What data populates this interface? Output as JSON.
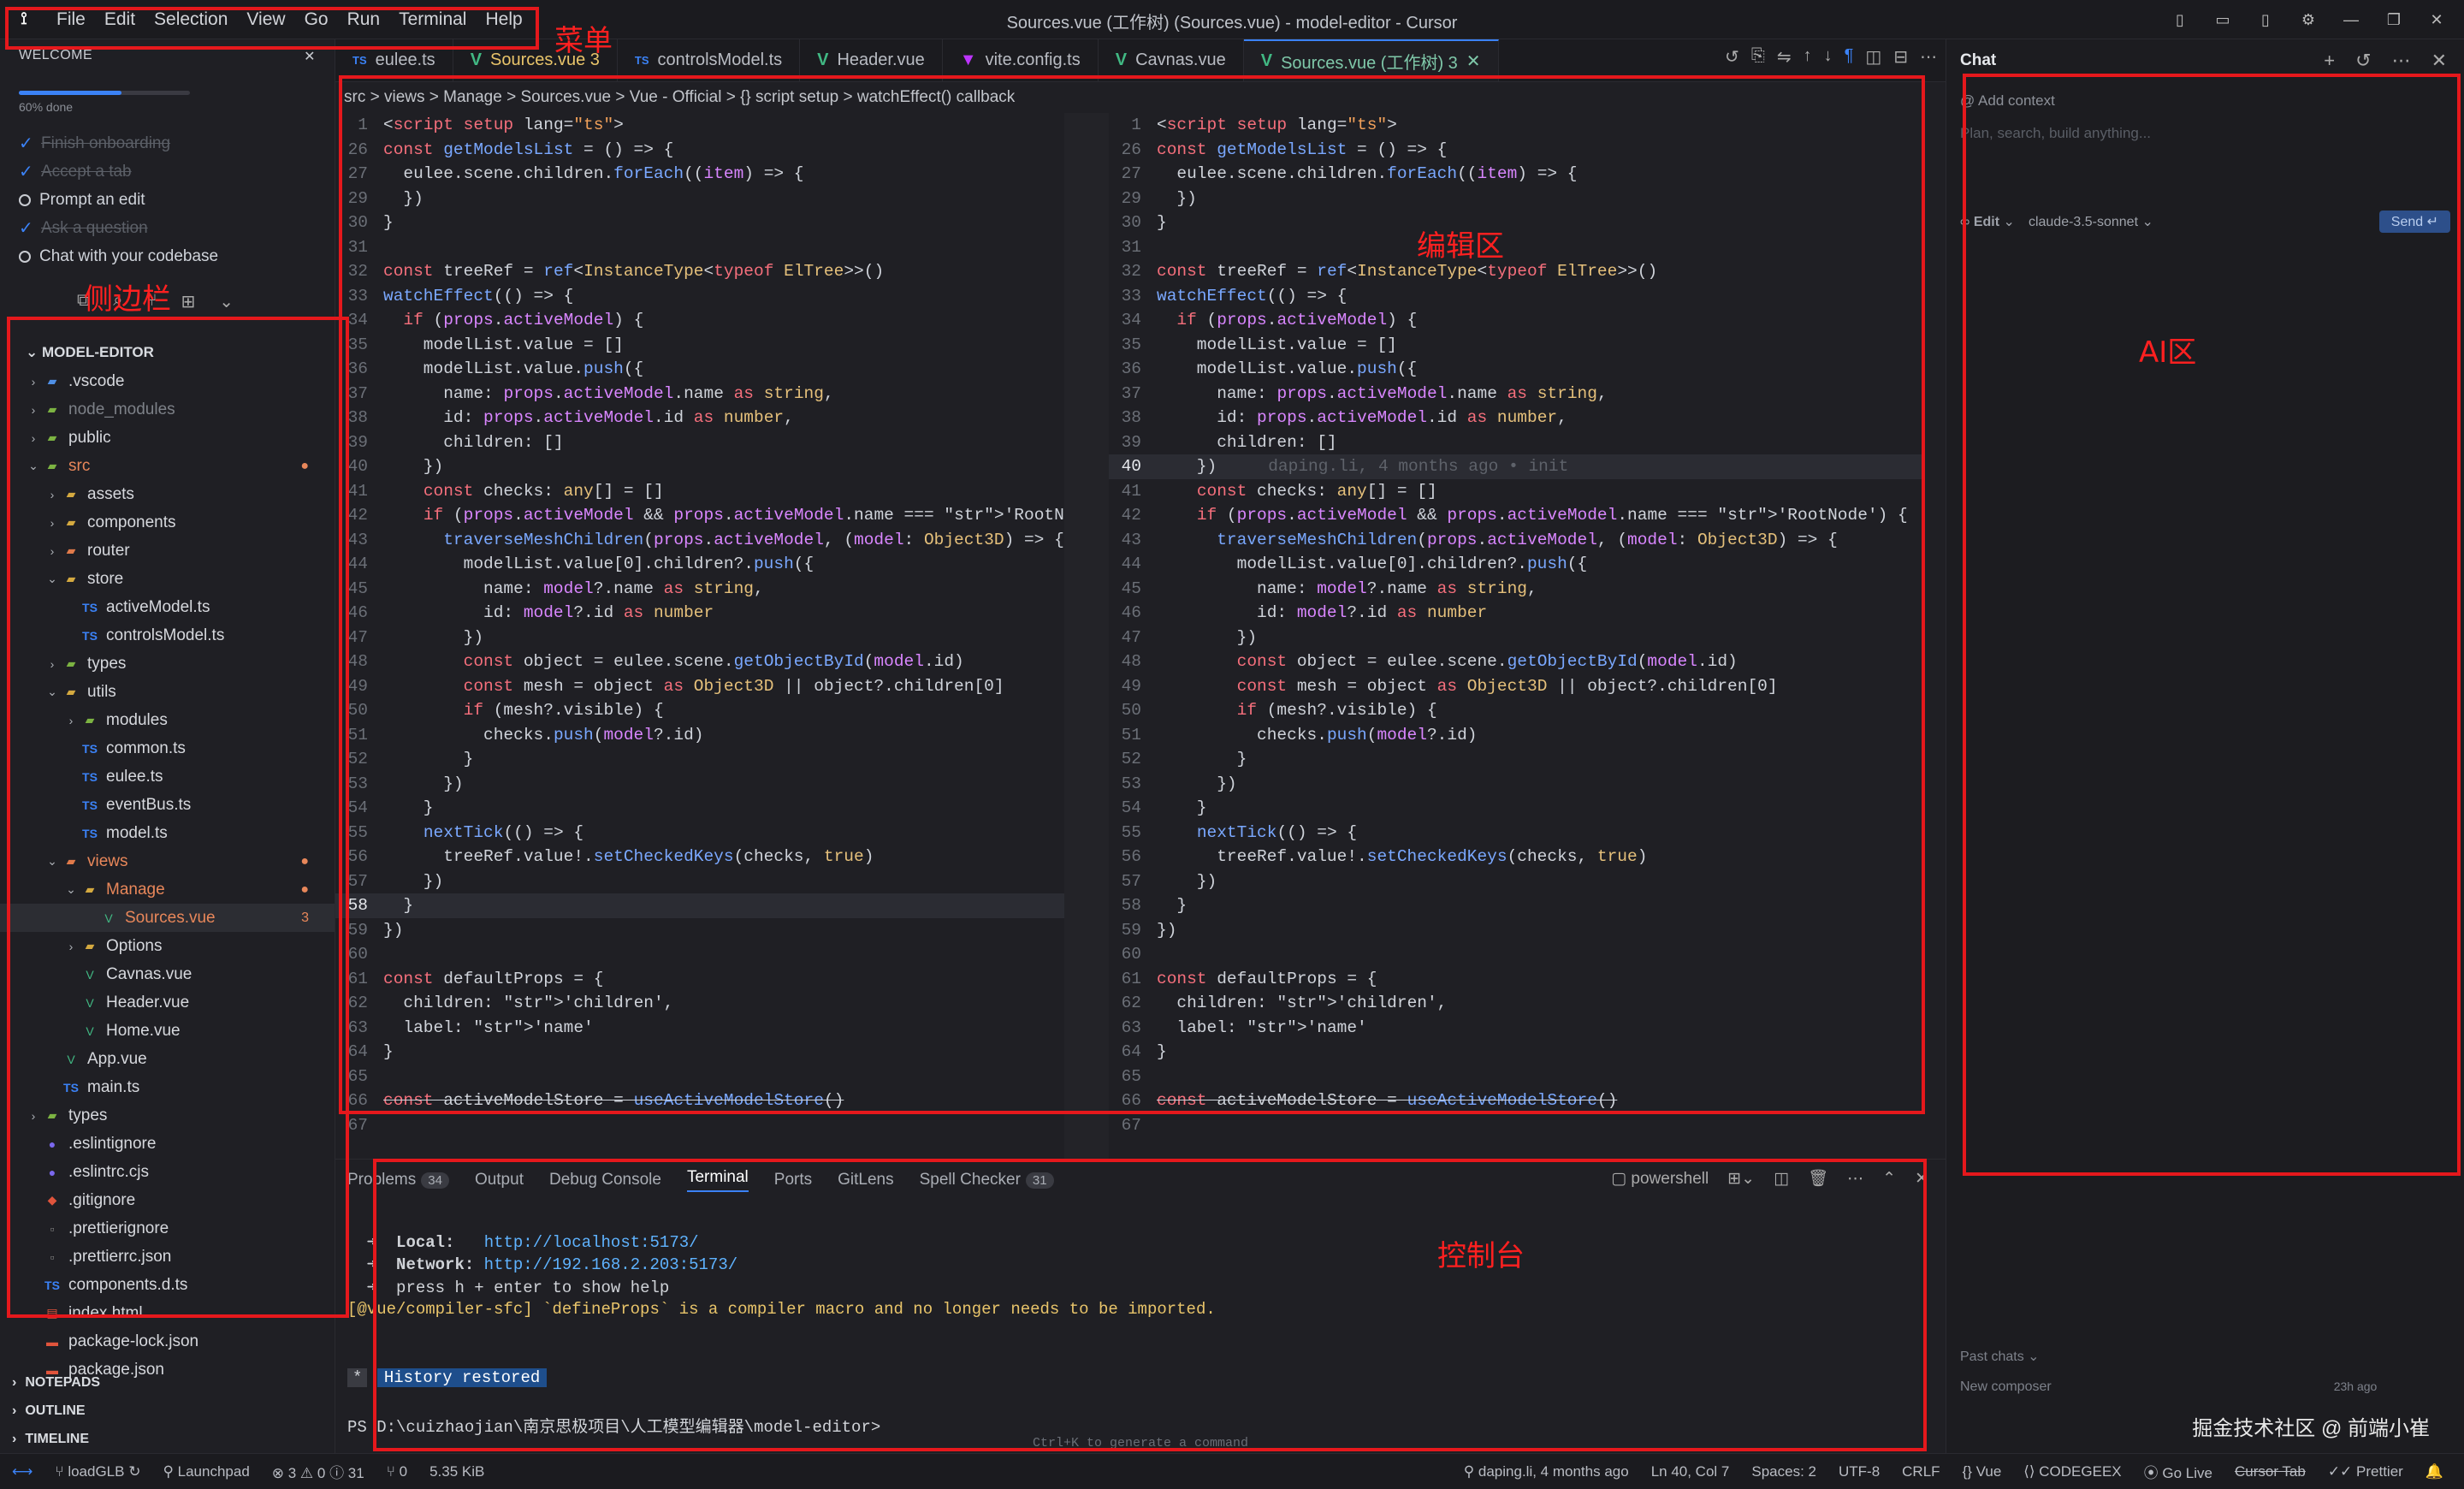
{
  "window": {
    "title": "Sources.vue (工作树) (Sources.vue) - model-editor - Cursor"
  },
  "menu": [
    "File",
    "Edit",
    "Selection",
    "View",
    "Go",
    "Run",
    "Terminal",
    "Help"
  ],
  "annotations": {
    "menu": "菜单",
    "sidebar": "侧边栏",
    "editor": "编辑区",
    "ai": "AI区",
    "console": "控制台"
  },
  "welcome": {
    "title": "WELCOME",
    "progress_text": "60% done",
    "progress": 0.6,
    "items": [
      {
        "label": "Finish onboarding",
        "done": true
      },
      {
        "label": "Accept a tab",
        "done": true
      },
      {
        "label": "Prompt an edit",
        "done": false
      },
      {
        "label": "Ask a question",
        "done": true
      },
      {
        "label": "Chat with your codebase",
        "done": false
      }
    ]
  },
  "explorer": {
    "title": "MODEL-EDITOR",
    "items": [
      {
        "label": ".vscode",
        "depth": 0,
        "kind": "folder",
        "open": false,
        "color": "#4f8fe6"
      },
      {
        "label": "node_modules",
        "depth": 0,
        "kind": "folder",
        "open": false,
        "color": "#7cb342",
        "dim": true
      },
      {
        "label": "public",
        "depth": 0,
        "kind": "folder",
        "open": false,
        "color": "#7cb342"
      },
      {
        "label": "src",
        "depth": 0,
        "kind": "folder",
        "open": true,
        "color": "#7cb342",
        "accent": true,
        "badge": "●"
      },
      {
        "label": "assets",
        "depth": 1,
        "kind": "folder",
        "open": false,
        "color": "#d4a940"
      },
      {
        "label": "components",
        "depth": 1,
        "kind": "folder",
        "open": false,
        "color": "#d4a940"
      },
      {
        "label": "router",
        "depth": 1,
        "kind": "folder",
        "open": false,
        "color": "#e07a4a"
      },
      {
        "label": "store",
        "depth": 1,
        "kind": "folder",
        "open": true,
        "color": "#d4a940"
      },
      {
        "label": "activeModel.ts",
        "depth": 2,
        "kind": "ts"
      },
      {
        "label": "controlsModel.ts",
        "depth": 2,
        "kind": "ts"
      },
      {
        "label": "types",
        "depth": 1,
        "kind": "folder",
        "open": false,
        "color": "#7cb342"
      },
      {
        "label": "utils",
        "depth": 1,
        "kind": "folder",
        "open": true,
        "color": "#d4a940"
      },
      {
        "label": "modules",
        "depth": 2,
        "kind": "folder",
        "open": false,
        "color": "#7cb342"
      },
      {
        "label": "common.ts",
        "depth": 2,
        "kind": "ts"
      },
      {
        "label": "eulee.ts",
        "depth": 2,
        "kind": "ts"
      },
      {
        "label": "eventBus.ts",
        "depth": 2,
        "kind": "ts"
      },
      {
        "label": "model.ts",
        "depth": 2,
        "kind": "ts"
      },
      {
        "label": "views",
        "depth": 1,
        "kind": "folder",
        "open": true,
        "color": "#e07a4a",
        "accent": true,
        "badge": "●"
      },
      {
        "label": "Manage",
        "depth": 2,
        "kind": "folder",
        "open": true,
        "color": "#d4a940",
        "accent": true,
        "badge": "●"
      },
      {
        "label": "Sources.vue",
        "depth": 3,
        "kind": "vue",
        "accent": true,
        "selected": true,
        "badge": "3"
      },
      {
        "label": "Options",
        "depth": 2,
        "kind": "folder",
        "open": false,
        "color": "#d4a940"
      },
      {
        "label": "Cavnas.vue",
        "depth": 2,
        "kind": "vue"
      },
      {
        "label": "Header.vue",
        "depth": 2,
        "kind": "vue"
      },
      {
        "label": "Home.vue",
        "depth": 2,
        "kind": "vue"
      },
      {
        "label": "App.vue",
        "depth": 1,
        "kind": "vue"
      },
      {
        "label": "main.ts",
        "depth": 1,
        "kind": "ts"
      },
      {
        "label": "types",
        "depth": 0,
        "kind": "folder",
        "open": false,
        "color": "#7cb342"
      },
      {
        "label": ".eslintignore",
        "depth": 0,
        "kind": "dot",
        "color": "#7b68ee"
      },
      {
        "label": ".eslintrc.cjs",
        "depth": 0,
        "kind": "dot",
        "color": "#7b68ee"
      },
      {
        "label": ".gitignore",
        "depth": 0,
        "kind": "git"
      },
      {
        "label": ".prettierignore",
        "depth": 0,
        "kind": "plain"
      },
      {
        "label": ".prettierrc.json",
        "depth": 0,
        "kind": "plain"
      },
      {
        "label": "components.d.ts",
        "depth": 0,
        "kind": "ts"
      },
      {
        "label": "index.html",
        "depth": 0,
        "kind": "html"
      },
      {
        "label": "package-lock.json",
        "depth": 0,
        "kind": "json"
      },
      {
        "label": "package.json",
        "depth": 0,
        "kind": "json"
      }
    ],
    "footer": [
      "NOTEPADS",
      "OUTLINE",
      "TIMELINE"
    ]
  },
  "tabs": [
    {
      "label": "eulee.ts",
      "kind": "ts"
    },
    {
      "label": "Sources.vue 3",
      "kind": "vue",
      "warn": true
    },
    {
      "label": "controlsModel.ts",
      "kind": "ts"
    },
    {
      "label": "Header.vue",
      "kind": "vue"
    },
    {
      "label": "vite.config.ts",
      "kind": "vite"
    },
    {
      "label": "Cavnas.vue",
      "kind": "vue"
    },
    {
      "label": "Sources.vue (工作树) 3",
      "kind": "vue",
      "active": true
    }
  ],
  "breadcrumb": "src > views > Manage > Sources.vue > Vue - Official > {} script setup > watchEffect() callback",
  "code": [
    {
      "n": "1",
      "t": "<script setup lang=\"ts\">"
    },
    {
      "n": "26",
      "t": "const getModelsList = () => {"
    },
    {
      "n": "27",
      "t": "  eulee.scene.children.forEach((item) => {"
    },
    {
      "n": "29",
      "t": "  })"
    },
    {
      "n": "30",
      "t": "}"
    },
    {
      "n": "31",
      "t": ""
    },
    {
      "n": "32",
      "t": "const treeRef = ref<InstanceType<typeof ElTree>>()"
    },
    {
      "n": "33",
      "t": "watchEffect(() => {"
    },
    {
      "n": "34",
      "t": "  if (props.activeModel) {"
    },
    {
      "n": "35",
      "t": "    modelList.value = []"
    },
    {
      "n": "36",
      "t": "    modelList.value.push({"
    },
    {
      "n": "37",
      "t": "      name: props.activeModel.name as string,"
    },
    {
      "n": "38",
      "t": "      id: props.activeModel.id as number,"
    },
    {
      "n": "39",
      "t": "      children: []"
    },
    {
      "n": "40",
      "t": "    })"
    },
    {
      "n": "41",
      "t": "    const checks: any[] = []"
    },
    {
      "n": "42",
      "t": "    if (props.activeModel && props.activeModel.name === 'RootNode') {"
    },
    {
      "n": "43",
      "t": "      traverseMeshChildren(props.activeModel, (model: Object3D) => {"
    },
    {
      "n": "44",
      "t": "        modelList.value[0].children?.push({"
    },
    {
      "n": "45",
      "t": "          name: model?.name as string,"
    },
    {
      "n": "46",
      "t": "          id: model?.id as number"
    },
    {
      "n": "47",
      "t": "        })"
    },
    {
      "n": "48",
      "t": "        const object = eulee.scene.getObjectById(model.id)"
    },
    {
      "n": "49",
      "t": "        const mesh = object as Object3D || object?.children[0]"
    },
    {
      "n": "50",
      "t": "        if (mesh?.visible) {"
    },
    {
      "n": "51",
      "t": "          checks.push(model?.id)"
    },
    {
      "n": "52",
      "t": "        }"
    },
    {
      "n": "53",
      "t": "      })"
    },
    {
      "n": "54",
      "t": "    }"
    },
    {
      "n": "55",
      "t": "    nextTick(() => {"
    },
    {
      "n": "56",
      "t": "      treeRef.value!.setCheckedKeys(checks, true)"
    },
    {
      "n": "57",
      "t": "    })"
    },
    {
      "n": "58",
      "t": "  }"
    },
    {
      "n": "59",
      "t": "})"
    },
    {
      "n": "60",
      "t": ""
    },
    {
      "n": "61",
      "t": "const defaultProps = {"
    },
    {
      "n": "62",
      "t": "  children: 'children',"
    },
    {
      "n": "63",
      "t": "  label: 'name'"
    },
    {
      "n": "64",
      "t": "}"
    },
    {
      "n": "65",
      "t": ""
    },
    {
      "n": "66",
      "t": "const activeModelStore = useActiveModelStore()"
    },
    {
      "n": "67",
      "t": ""
    }
  ],
  "blame": "daping.li, 4 months ago • init",
  "panel": {
    "tabs": [
      {
        "label": "Problems",
        "count": "34"
      },
      {
        "label": "Output"
      },
      {
        "label": "Debug Console"
      },
      {
        "label": "Terminal",
        "active": true
      },
      {
        "label": "Ports"
      },
      {
        "label": "GitLens"
      },
      {
        "label": "Spell Checker",
        "count": "31"
      }
    ],
    "shell": "powershell",
    "local_label": "Local:",
    "local_url": "http://localhost:5173/",
    "network_label": "Network:",
    "network_url": "http://192.168.2.203:5173/",
    "help_line": "press h + enter to show help",
    "warn_line": "[@vue/compiler-sfc] `defineProps` is a compiler macro and no longer needs to be imported.",
    "restored": "History restored",
    "prompt": "PS D:\\cuizhaojian\\南京思极项目\\人工模型编辑器\\model-editor>",
    "hint": "Ctrl+K to generate a command"
  },
  "chat": {
    "title": "Chat",
    "add_context": "Add context",
    "placeholder": "Plan, search, build anything...",
    "mode": "Edit",
    "model": "claude-3.5-sonnet",
    "send": "Send",
    "past": "Past chats",
    "new_composer": "New composer",
    "time": "23h ago"
  },
  "watermark": "掘金技术社区 @ 前端小崔",
  "status": {
    "branch": "loadGLB",
    "launchpad": "Launchpad",
    "problems": "⊗ 3 ⚠ 0 ⓘ 31",
    "ports": "⑂ 0",
    "size": "5.35 KiB",
    "blame": "daping.li, 4 months ago",
    "position": "Ln 40, Col 7",
    "spaces": "Spaces: 2",
    "encoding": "UTF-8",
    "eol": "CRLF",
    "lang": "Vue",
    "codegeex": "CODEGEEX",
    "golive": "Go Live",
    "cursortab": "Cursor Tab",
    "prettier": "Prettier"
  }
}
